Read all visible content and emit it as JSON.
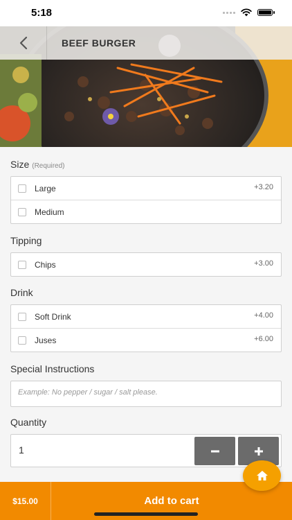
{
  "status_bar": {
    "time": "5:18"
  },
  "header": {
    "title": "BEEF BURGER"
  },
  "sections": {
    "size": {
      "title": "Size",
      "required_note": "(Required)",
      "options": [
        {
          "label": "Large",
          "price": "+3.20"
        },
        {
          "label": "Medium",
          "price": ""
        }
      ]
    },
    "tipping": {
      "title": "Tipping",
      "options": [
        {
          "label": "Chips",
          "price": "+3.00"
        }
      ]
    },
    "drink": {
      "title": "Drink",
      "options": [
        {
          "label": "Soft Drink",
          "price": "+4.00"
        },
        {
          "label": "Juses",
          "price": "+6.00"
        }
      ]
    },
    "instructions": {
      "title": "Special Instructions",
      "placeholder": "Example: No pepper / sugar / salt please."
    },
    "quantity": {
      "title": "Quantity",
      "value": "1"
    }
  },
  "bottom_bar": {
    "total": "$15.00",
    "add_to_cart_label": "Add to cart"
  },
  "icons": {
    "back": "chevron-left-icon",
    "minus": "minus-icon",
    "plus": "plus-icon",
    "home": "home-icon"
  },
  "colors": {
    "accent": "#f28a00",
    "fab": "#f5a000",
    "stepper": "#6b6b6b"
  }
}
